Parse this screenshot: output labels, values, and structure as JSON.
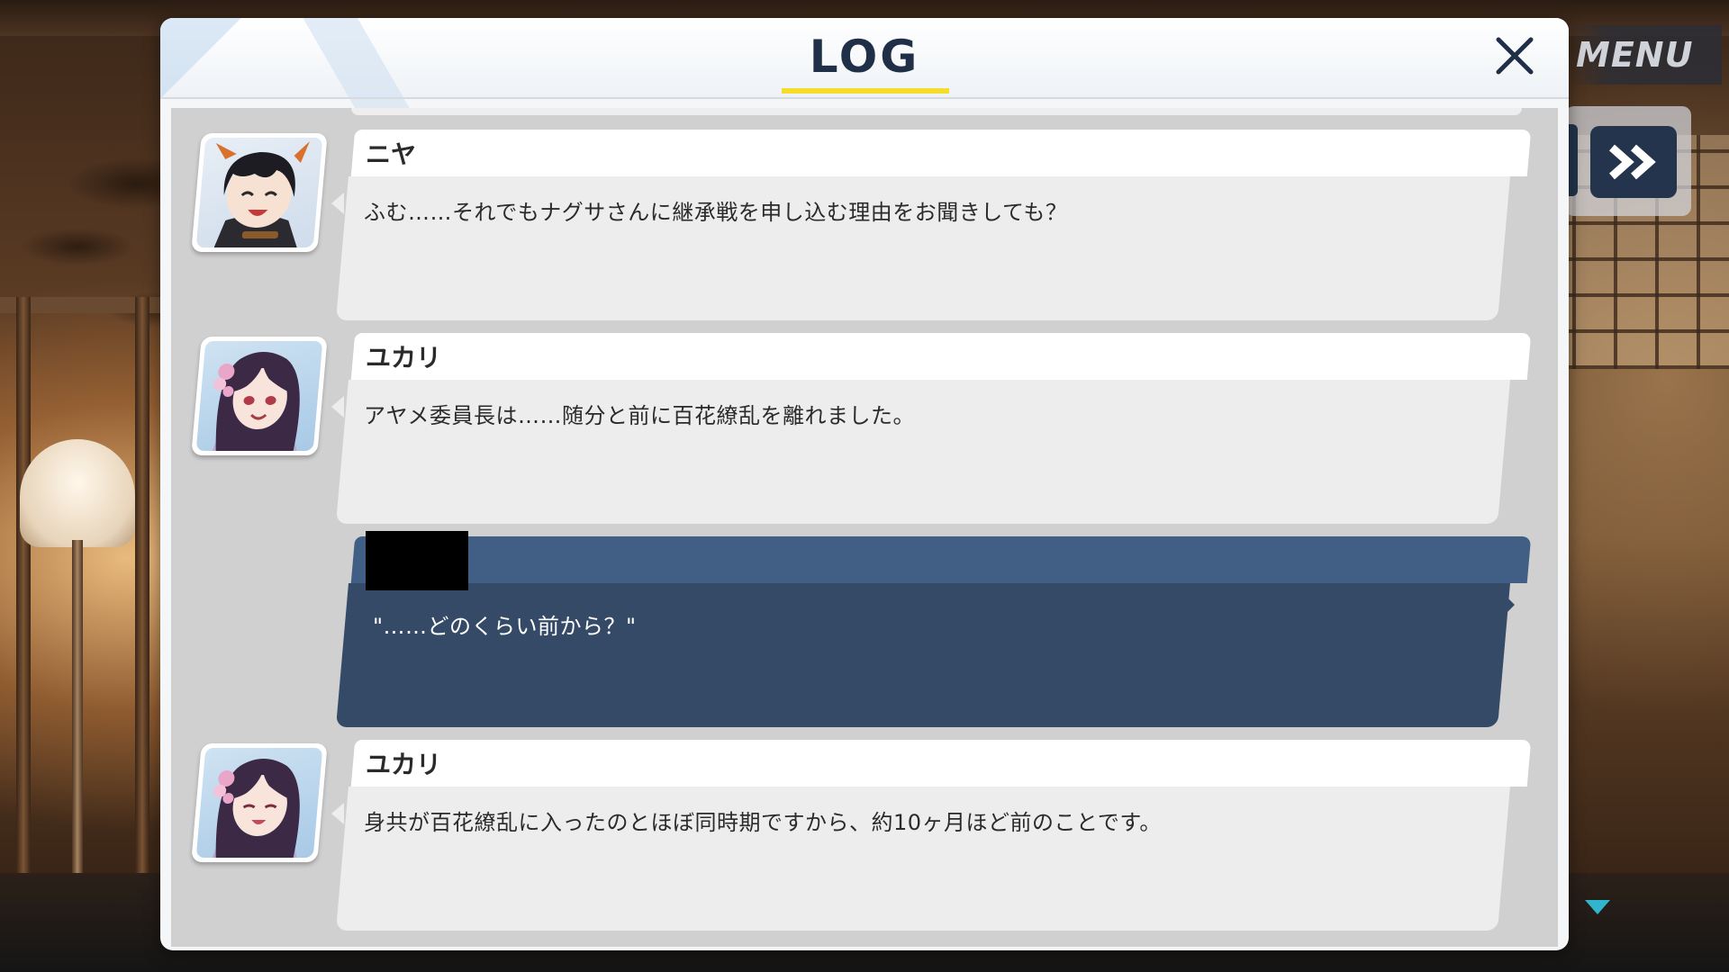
{
  "hud": {
    "menu_label": "MENU",
    "fast_forward_icon": "double-chevron-right-icon",
    "scroll_down_icon": "triangle-down-icon"
  },
  "dialog": {
    "title": "LOG",
    "close_icon": "close-icon",
    "accent_color": "#f4dd2b",
    "title_color": "#1f2f48"
  },
  "log": {
    "entries": [
      {
        "speaker": "ニヤ",
        "text": "ふむ……それでもナグサさんに継承戦を申し込む理由をお聞きしても？",
        "avatar": "nya-portrait"
      },
      {
        "speaker": "ユカリ",
        "text": "アヤメ委員長は……随分と前に百花繚乱を離れました。",
        "avatar": "yukari-portrait"
      },
      {
        "speaker": "",
        "text": "\"……どのくらい前から？\"",
        "avatar": ""
      },
      {
        "speaker": "ユカリ",
        "text": "身共が百花繚乱に入ったのとほぼ同時期ですから、約10ヶ月ほど前のことです。",
        "avatar": "yukari-portrait"
      }
    ],
    "player_bubble_color": "#344a66",
    "npc_bubble_color": "#ededed"
  }
}
